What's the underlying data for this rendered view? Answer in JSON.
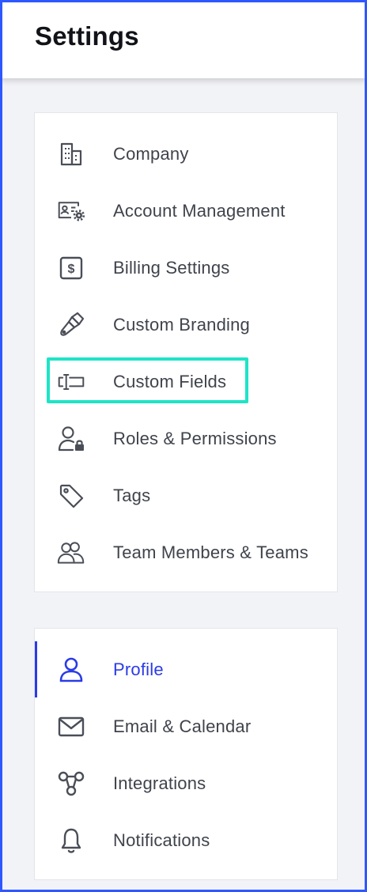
{
  "header": {
    "title": "Settings"
  },
  "org_settings": {
    "items": [
      {
        "label": "Company",
        "icon": "building-icon"
      },
      {
        "label": "Account Management",
        "icon": "id-card-gear-icon"
      },
      {
        "label": "Billing Settings",
        "icon": "dollar-square-icon"
      },
      {
        "label": "Custom Branding",
        "icon": "paintbrush-icon"
      },
      {
        "label": "Custom Fields",
        "icon": "text-field-icon"
      },
      {
        "label": "Roles & Permissions",
        "icon": "user-lock-icon"
      },
      {
        "label": "Tags",
        "icon": "tag-icon"
      },
      {
        "label": "Team Members & Teams",
        "icon": "users-icon"
      }
    ]
  },
  "personal_settings": {
    "items": [
      {
        "label": "Profile",
        "icon": "user-icon",
        "active": true
      },
      {
        "label": "Email & Calendar",
        "icon": "envelope-icon"
      },
      {
        "label": "Integrations",
        "icon": "integrations-icon"
      },
      {
        "label": "Notifications",
        "icon": "bell-icon"
      }
    ]
  },
  "highlight": {
    "target": "Custom Fields",
    "color": "#1de4c6"
  },
  "colors": {
    "accent": "#2a3be6",
    "frame": "#2f57ff",
    "text": "#3f434b",
    "icon": "#4a4e57"
  }
}
